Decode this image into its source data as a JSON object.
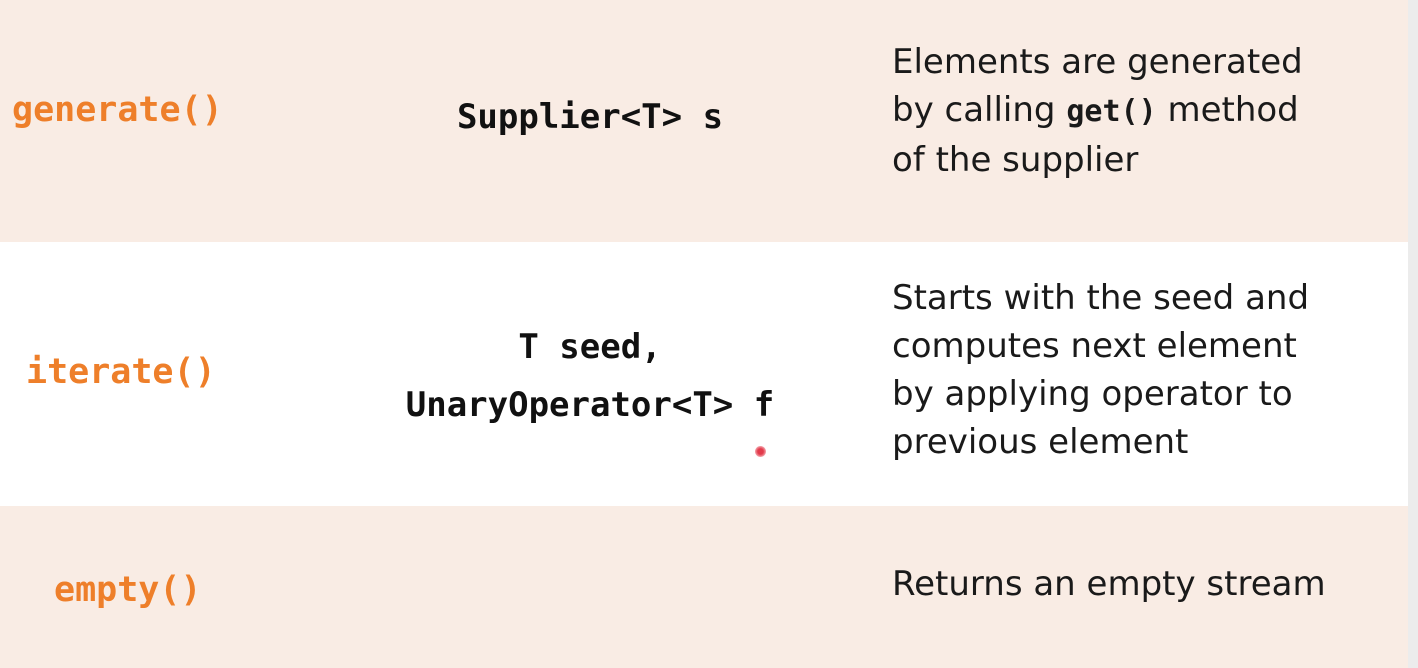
{
  "rows": [
    {
      "method": "generate()",
      "params": [
        "Supplier<T> s"
      ],
      "description": {
        "line1": "Elements are generated",
        "line2_before": "by calling ",
        "line2_code": "get()",
        "line2_after": " method",
        "line3": "of the supplier"
      }
    },
    {
      "method": "iterate()",
      "params": [
        "T seed,",
        "UnaryOperator<T> f"
      ],
      "description": {
        "line1": "Starts with the seed and",
        "line2": "computes next element",
        "line3": "by applying operator to",
        "line4": "previous element"
      }
    },
    {
      "method": "empty()",
      "params": [],
      "description": {
        "line1": "Returns an empty stream"
      }
    }
  ],
  "colors": {
    "method_orange": "#ee7f2a",
    "shaded_row": "#f9ece4",
    "pointer": "#e23b4b"
  }
}
